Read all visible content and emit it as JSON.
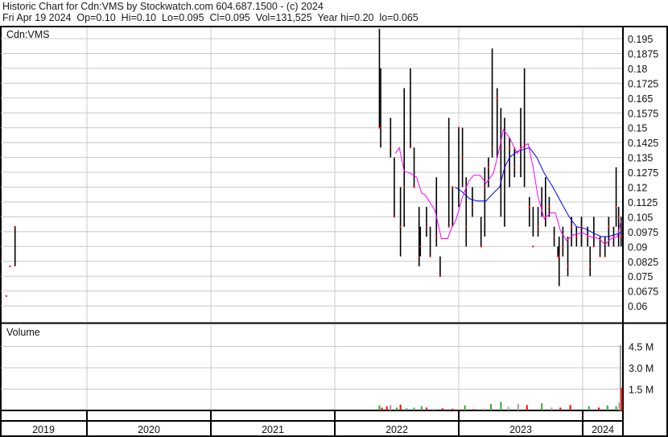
{
  "header": {
    "title": "Historic Chart for Cdn:VMS by Stockwatch.com 604.687.1500 - (c) 2024",
    "quote": "Fri Apr 19 2024  Op=0.10  Hi=0.10  Lo=0.095  Cl=0.095  Vol=131,525  Year hi=0.20  lo=0.065"
  },
  "chart_data": {
    "type": "line",
    "symbol_label": "Cdn:VMS",
    "volume_label": "Volume",
    "years": [
      "2019",
      "2020",
      "2021",
      "2022",
      "2023",
      "2024"
    ],
    "price_ticks": [
      "0.195",
      "0.1875",
      "0.18",
      "0.1725",
      "0.165",
      "0.1575",
      "0.15",
      "0.1425",
      "0.135",
      "0.1275",
      "0.12",
      "0.1125",
      "0.105",
      "0.0975",
      "0.09",
      "0.0825",
      "0.075",
      "0.0675",
      "0.06"
    ],
    "price_range": [
      0.0525,
      0.2025
    ],
    "volume_ticks": [
      "4.5 M",
      "3.0 M",
      "1.5 M"
    ],
    "volume_range": [
      0,
      5.3
    ],
    "colors": {
      "bar": "#000000",
      "close": "#ff0000",
      "ma_short": "#ff00ff",
      "ma_long": "#0000ff",
      "vol_up": "#33aa33",
      "vol_down": "#ff0000",
      "vol_flat": "#a0a0a0",
      "grid": "#c8c8c8"
    },
    "ohlc_columns": [
      "year_fraction",
      "high",
      "low",
      "close"
    ],
    "ohlc": [
      [
        2019.35,
        0.065,
        0.065,
        0.065
      ],
      [
        2019.38,
        0.08,
        0.08,
        0.08
      ],
      [
        2019.42,
        0.1,
        0.08,
        0.1
      ],
      [
        2022.36,
        0.2,
        0.15,
        0.15
      ],
      [
        2022.37,
        0.18,
        0.14,
        0.15
      ],
      [
        2022.45,
        0.155,
        0.135,
        0.14
      ],
      [
        2022.48,
        0.135,
        0.105,
        0.105
      ],
      [
        2022.53,
        0.12,
        0.085,
        0.1
      ],
      [
        2022.56,
        0.17,
        0.1,
        0.12
      ],
      [
        2022.61,
        0.18,
        0.14,
        0.14
      ],
      [
        2022.64,
        0.14,
        0.12,
        0.12
      ],
      [
        2022.68,
        0.11,
        0.08,
        0.085
      ],
      [
        2022.69,
        0.1,
        0.085,
        0.09
      ],
      [
        2022.74,
        0.11,
        0.095,
        0.1
      ],
      [
        2022.77,
        0.1,
        0.085,
        0.085
      ],
      [
        2022.82,
        0.125,
        0.09,
        0.095
      ],
      [
        2022.85,
        0.085,
        0.075,
        0.075
      ],
      [
        2022.92,
        0.155,
        0.1,
        0.1
      ],
      [
        2022.95,
        0.12,
        0.1,
        0.12
      ],
      [
        2023.0,
        0.15,
        0.11,
        0.15
      ],
      [
        2023.03,
        0.15,
        0.12,
        0.135
      ],
      [
        2023.06,
        0.125,
        0.09,
        0.1
      ],
      [
        2023.11,
        0.12,
        0.105,
        0.11
      ],
      [
        2023.18,
        0.105,
        0.09,
        0.09
      ],
      [
        2023.21,
        0.13,
        0.095,
        0.12
      ],
      [
        2023.24,
        0.135,
        0.12,
        0.13
      ],
      [
        2023.27,
        0.19,
        0.135,
        0.14
      ],
      [
        2023.31,
        0.17,
        0.135,
        0.165
      ],
      [
        2023.34,
        0.16,
        0.105,
        0.14
      ],
      [
        2023.37,
        0.155,
        0.1,
        0.13
      ],
      [
        2023.41,
        0.145,
        0.12,
        0.14
      ],
      [
        2023.45,
        0.14,
        0.125,
        0.13
      ],
      [
        2023.5,
        0.16,
        0.125,
        0.14
      ],
      [
        2023.53,
        0.18,
        0.12,
        0.14
      ],
      [
        2023.57,
        0.115,
        0.1,
        0.11
      ],
      [
        2023.6,
        0.11,
        0.095,
        0.09
      ],
      [
        2023.64,
        0.11,
        0.095,
        0.1
      ],
      [
        2023.67,
        0.12,
        0.105,
        0.11
      ],
      [
        2023.7,
        0.125,
        0.1,
        0.105
      ],
      [
        2023.73,
        0.115,
        0.105,
        0.11
      ],
      [
        2023.77,
        0.1,
        0.09,
        0.095
      ],
      [
        2023.8,
        0.09,
        0.085,
        0.085
      ],
      [
        2023.81,
        0.095,
        0.07,
        0.085
      ],
      [
        2023.84,
        0.1,
        0.085,
        0.09
      ],
      [
        2023.88,
        0.095,
        0.075,
        0.08
      ],
      [
        2023.91,
        0.105,
        0.09,
        0.1
      ],
      [
        2023.95,
        0.1,
        0.09,
        0.095
      ],
      [
        2023.99,
        0.105,
        0.09,
        0.1
      ],
      [
        2024.04,
        0.1,
        0.09,
        0.095
      ],
      [
        2024.06,
        0.09,
        0.075,
        0.08
      ],
      [
        2024.09,
        0.105,
        0.09,
        0.09
      ],
      [
        2024.14,
        0.095,
        0.085,
        0.085
      ],
      [
        2024.18,
        0.095,
        0.085,
        0.085
      ],
      [
        2024.21,
        0.105,
        0.09,
        0.1
      ],
      [
        2024.25,
        0.1,
        0.09,
        0.095
      ],
      [
        2024.27,
        0.13,
        0.1,
        0.11
      ],
      [
        2024.29,
        0.11,
        0.09,
        0.105
      ],
      [
        2024.31,
        0.105,
        0.09,
        0.095
      ]
    ],
    "ma_short": [
      [
        2022.49,
        0.137
      ],
      [
        2022.52,
        0.14
      ],
      [
        2022.56,
        0.128
      ],
      [
        2022.61,
        0.127
      ],
      [
        2022.66,
        0.125
      ],
      [
        2022.7,
        0.117
      ],
      [
        2022.73,
        0.116
      ],
      [
        2022.81,
        0.108
      ],
      [
        2022.86,
        0.094
      ],
      [
        2022.91,
        0.094
      ],
      [
        2022.94,
        0.099
      ],
      [
        2022.98,
        0.104
      ],
      [
        2023.03,
        0.115
      ],
      [
        2023.08,
        0.123
      ],
      [
        2023.12,
        0.126
      ],
      [
        2023.17,
        0.126
      ],
      [
        2023.22,
        0.122
      ],
      [
        2023.28,
        0.127
      ],
      [
        2023.33,
        0.14
      ],
      [
        2023.36,
        0.149
      ],
      [
        2023.41,
        0.145
      ],
      [
        2023.47,
        0.137
      ],
      [
        2023.51,
        0.14
      ],
      [
        2023.56,
        0.142
      ],
      [
        2023.6,
        0.13
      ],
      [
        2023.64,
        0.115
      ],
      [
        2023.69,
        0.104
      ],
      [
        2023.74,
        0.107
      ],
      [
        2023.78,
        0.107
      ],
      [
        2023.82,
        0.098
      ],
      [
        2023.87,
        0.093
      ],
      [
        2023.93,
        0.096
      ],
      [
        2024.0,
        0.097
      ],
      [
        2024.06,
        0.095
      ],
      [
        2024.13,
        0.094
      ],
      [
        2024.18,
        0.091
      ],
      [
        2024.23,
        0.094
      ],
      [
        2024.28,
        0.095
      ],
      [
        2024.31,
        0.103
      ]
    ],
    "ma_long": [
      [
        2022.97,
        0.12
      ],
      [
        2023.02,
        0.118
      ],
      [
        2023.09,
        0.114
      ],
      [
        2023.15,
        0.113
      ],
      [
        2023.22,
        0.113
      ],
      [
        2023.28,
        0.117
      ],
      [
        2023.33,
        0.12
      ],
      [
        2023.37,
        0.13
      ],
      [
        2023.41,
        0.135
      ],
      [
        2023.47,
        0.138
      ],
      [
        2023.52,
        0.139
      ],
      [
        2023.57,
        0.14
      ],
      [
        2023.63,
        0.135
      ],
      [
        2023.69,
        0.127
      ],
      [
        2023.76,
        0.12
      ],
      [
        2023.82,
        0.113
      ],
      [
        2023.89,
        0.105
      ],
      [
        2023.95,
        0.1
      ],
      [
        2024.02,
        0.099
      ],
      [
        2024.08,
        0.097
      ],
      [
        2024.15,
        0.095
      ],
      [
        2024.21,
        0.095
      ],
      [
        2024.26,
        0.096
      ],
      [
        2024.31,
        0.097
      ]
    ],
    "volume_columns": [
      "year_fraction",
      "volume_millions",
      "direction"
    ],
    "volume": [
      [
        2022.36,
        0.35,
        "up"
      ],
      [
        2022.38,
        0.2,
        "down"
      ],
      [
        2022.42,
        0.3,
        "down"
      ],
      [
        2022.45,
        0.38,
        "flat"
      ],
      [
        2022.5,
        0.2,
        "up"
      ],
      [
        2022.53,
        0.4,
        "down"
      ],
      [
        2022.58,
        0.15,
        "up"
      ],
      [
        2022.64,
        0.2,
        "up"
      ],
      [
        2022.7,
        0.3,
        "up"
      ],
      [
        2022.74,
        0.2,
        "down"
      ],
      [
        2022.8,
        0.1,
        "flat"
      ],
      [
        2022.87,
        0.15,
        "down"
      ],
      [
        2022.95,
        0.12,
        "down"
      ],
      [
        2023.05,
        0.35,
        "up"
      ],
      [
        2023.12,
        0.1,
        "down"
      ],
      [
        2023.2,
        0.12,
        "flat"
      ],
      [
        2023.26,
        0.45,
        "up"
      ],
      [
        2023.34,
        0.6,
        "up"
      ],
      [
        2023.4,
        0.25,
        "flat"
      ],
      [
        2023.48,
        0.45,
        "flat"
      ],
      [
        2023.55,
        0.38,
        "down"
      ],
      [
        2023.67,
        0.5,
        "up"
      ],
      [
        2023.75,
        0.2,
        "flat"
      ],
      [
        2023.82,
        0.2,
        "down"
      ],
      [
        2023.9,
        0.38,
        "down"
      ],
      [
        2024.05,
        0.3,
        "up"
      ],
      [
        2024.13,
        0.2,
        "down"
      ],
      [
        2024.2,
        0.35,
        "up"
      ],
      [
        2024.27,
        0.3,
        "up"
      ],
      [
        2024.295,
        0.55,
        "flat"
      ],
      [
        2024.305,
        4.6,
        "flat"
      ],
      [
        2024.315,
        1.6,
        "down"
      ]
    ]
  }
}
